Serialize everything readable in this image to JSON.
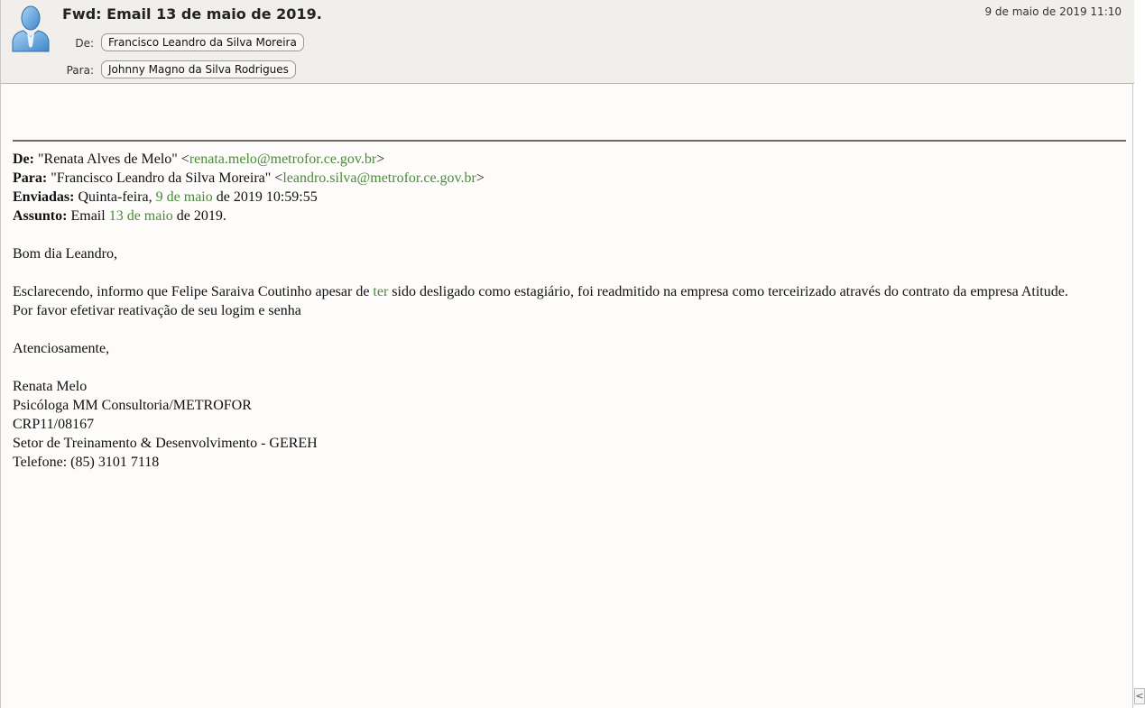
{
  "header": {
    "subject": "Fwd: Email 13 de maio de 2019.",
    "date": "9 de maio de 2019 11:10",
    "from_label": "De:",
    "from": "Francisco Leandro da Silva Moreira",
    "to_label": "Para:",
    "to": "Johnny Magno da Silva Rodrigues"
  },
  "forwarded": {
    "from_label": "De:",
    "from_name": "\"Renata Alves de Melo\" <",
    "from_email": "renata.melo@metrofor.ce.gov.br",
    "from_close": ">",
    "to_label": "Para:",
    "to_name": "\"Francisco Leandro da Silva Moreira\" <",
    "to_email": "leandro.silva@metrofor.ce.gov.br",
    "to_close": ">",
    "sent_label": "Enviadas:",
    "sent_pre": "Quinta-feira, ",
    "sent_link": "9 de maio",
    "sent_post": " de 2019 10:59:55",
    "subject_label": "Assunto:",
    "subject_pre": "Email ",
    "subject_link": "13 de maio",
    "subject_post": " de 2019."
  },
  "message": {
    "greeting": "Bom dia Leandro,",
    "para1_pre": "Esclarecendo, informo que Felipe Saraiva Coutinho apesar de ",
    "para1_link": "ter",
    "para1_post": " sido desligado como estagiário, foi readmitido na empresa como terceirizado através do contrato da empresa Atitude.",
    "para2": "Por favor efetivar reativação de seu logim e senha",
    "closing": "Atenciosamente,",
    "signature": [
      "Renata Melo",
      "Psicóloga MM Consultoria/METROFOR",
      "CRP11/08167",
      "Setor de Treinamento & Desenvolvimento - GEREH",
      "Telefone: (85) 3101 7118"
    ]
  },
  "scroll_button": "<",
  "colors": {
    "header_bg": "#f1efeb",
    "link": "#4a8a3a",
    "avatar": "#5a9fd8"
  },
  "icons": {
    "avatar": "person-avatar-icon"
  }
}
